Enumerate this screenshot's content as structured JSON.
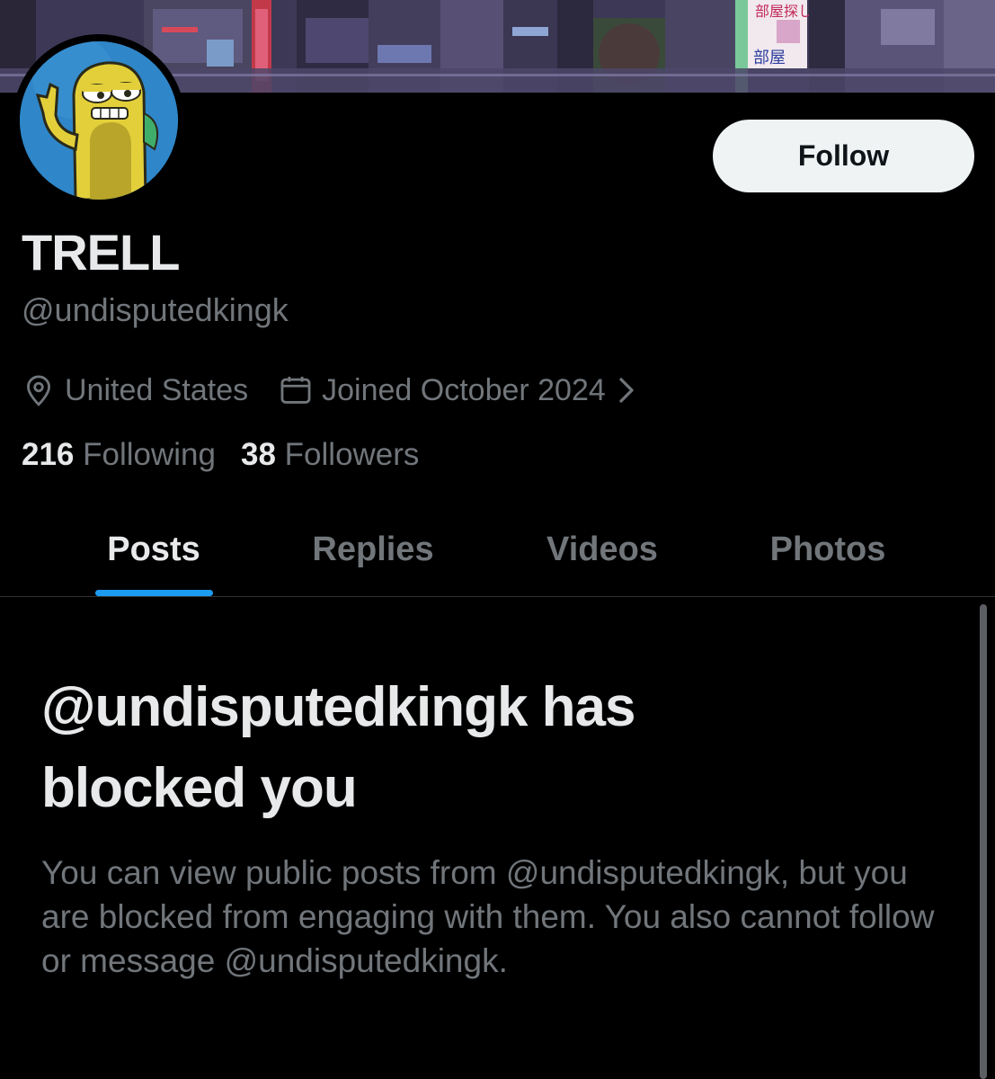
{
  "profile": {
    "display_name": "TRELL",
    "handle": "@undisputedkingk",
    "location": "United States",
    "joined": "Joined October 2024",
    "following_count": "216",
    "following_label": "Following",
    "followers_count": "38",
    "followers_label": "Followers"
  },
  "actions": {
    "follow_label": "Follow"
  },
  "tabs": [
    {
      "label": "Posts",
      "active": true
    },
    {
      "label": "Replies",
      "active": false
    },
    {
      "label": "Videos",
      "active": false
    },
    {
      "label": "Photos",
      "active": false
    }
  ],
  "blocked_notice": {
    "title_line1": "@undisputedkingk has",
    "title_line2": "blocked you",
    "body": "You can view public posts from @undisputedkingk, but you are blocked from engaging with them. You also cannot follow or message @undisputedkingk."
  },
  "banner_sign": {
    "line1": "部屋探し",
    "line2": "部屋"
  },
  "icons": {
    "location": "location-pin-icon",
    "joined": "calendar-icon",
    "joined_more": "chevron-right-icon"
  },
  "colors": {
    "background": "#000000",
    "primary_text": "#e7e9ea",
    "secondary_text": "#71767b",
    "accent": "#1d9bf0",
    "follow_button_bg": "#eff3f4",
    "divider": "#2f3336"
  }
}
